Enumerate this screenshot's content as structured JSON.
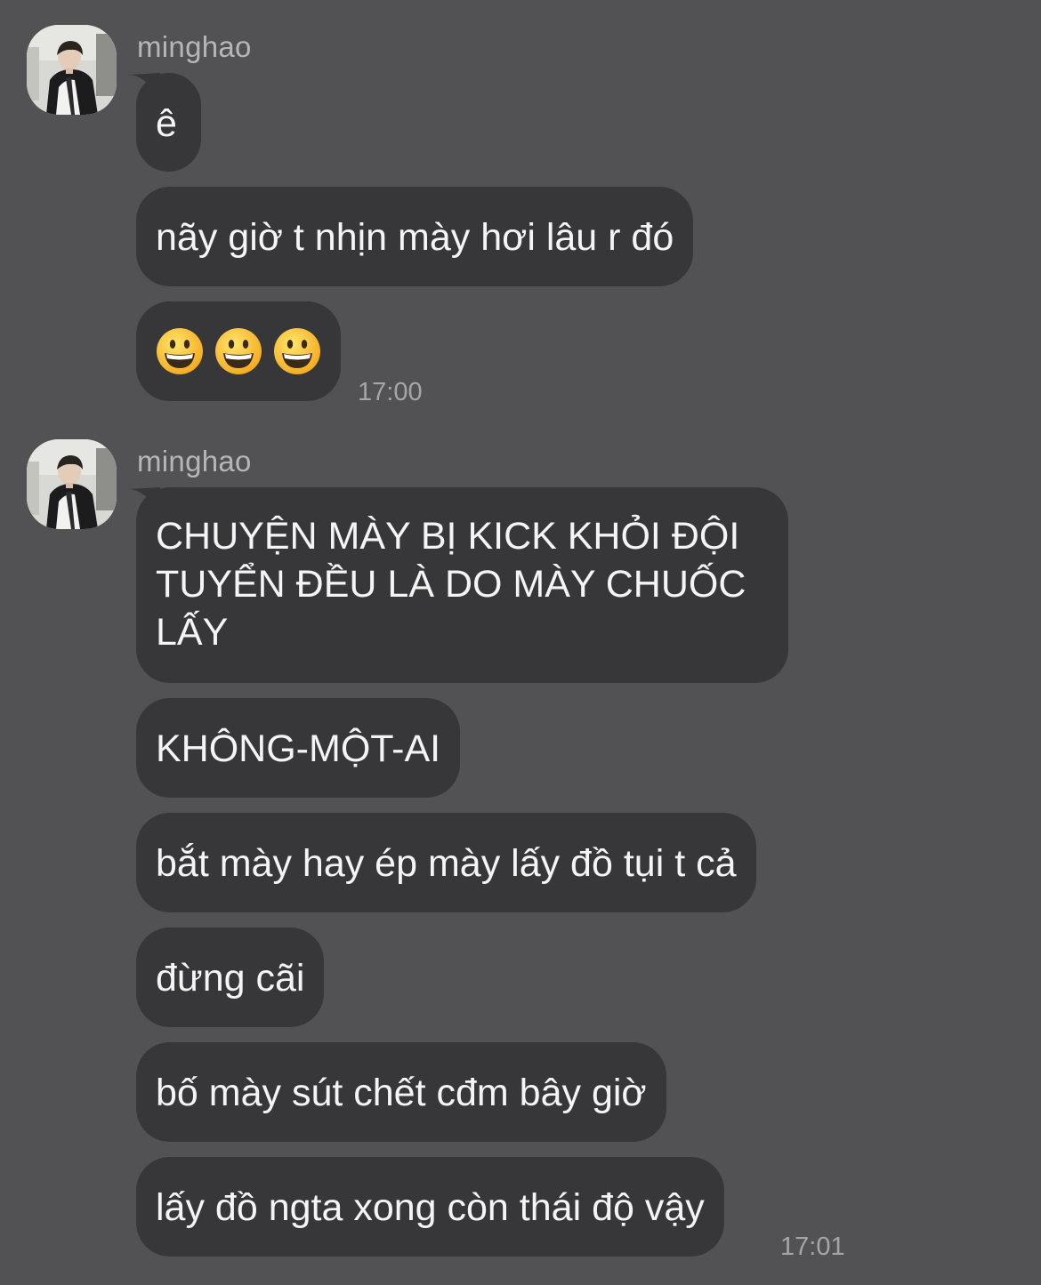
{
  "colors": {
    "background": "#525153",
    "bubble": "#373638",
    "text": "#f4f4f5",
    "sender": "#b6b5b7",
    "timestamp": "#a6a5a8"
  },
  "groups": [
    {
      "sender": "minghao",
      "messages": [
        {
          "text": "ê"
        },
        {
          "text": "nãy giờ t nhịn mày hơi lâu r đó"
        },
        {
          "emoji": [
            "grinning-face-emoji",
            "grinning-face-emoji",
            "grinning-face-emoji"
          ]
        }
      ],
      "time": "17:00"
    },
    {
      "sender": "minghao",
      "messages": [
        {
          "lines": [
            "CHUYỆN MÀY BỊ KICK KHỎI ĐỘI",
            "TUYỂN ĐỀU LÀ DO MÀY CHUỐC",
            "LẤY"
          ]
        },
        {
          "text": "KHÔNG-MỘT-AI"
        },
        {
          "text": "bắt mày hay ép mày lấy đồ tụi t cả"
        },
        {
          "text": "đừng cãi"
        },
        {
          "text": "bố mày sút chết cđm bây giờ"
        },
        {
          "text": "lấy đồ ngta xong còn thái độ vậy"
        }
      ],
      "time": "17:01"
    }
  ]
}
